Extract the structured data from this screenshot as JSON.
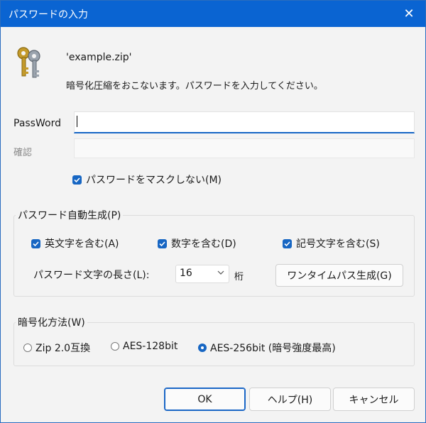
{
  "window": {
    "title": "パスワードの入力",
    "close_glyph": "✕"
  },
  "header": {
    "file_name": "'example.zip'",
    "message": "暗号化圧縮をおこないます。パスワードを入力してください。",
    "icon": "keys-icon"
  },
  "password": {
    "label": "PassWord",
    "value": ""
  },
  "confirm": {
    "label": "確認",
    "value": ""
  },
  "unmask": {
    "label": "パスワードをマスクしない(M)",
    "checked": true
  },
  "generator": {
    "title": "パスワード自動生成(P)",
    "alpha": {
      "label": "英文字を含む(A)",
      "checked": true
    },
    "digits": {
      "label": "数字を含む(D)",
      "checked": true
    },
    "symbols": {
      "label": "記号文字を含む(S)",
      "checked": true
    },
    "length_label": "パスワード文字の長さ(L):",
    "length_value": "16",
    "length_unit": "桁",
    "onetime_button": "ワンタイムパス生成(G)"
  },
  "encryption": {
    "title": "暗号化方法(W)",
    "options": [
      {
        "label": "Zip 2.0互換",
        "selected": false
      },
      {
        "label": "AES-128bit",
        "selected": false
      },
      {
        "label": "AES-256bit (暗号強度最高)",
        "selected": true
      }
    ]
  },
  "buttons": {
    "ok": "OK",
    "help": "ヘルプ(H)",
    "cancel": "キャンセル"
  },
  "colors": {
    "accent": "#1766c3",
    "titlebar": "#0a64d2"
  }
}
